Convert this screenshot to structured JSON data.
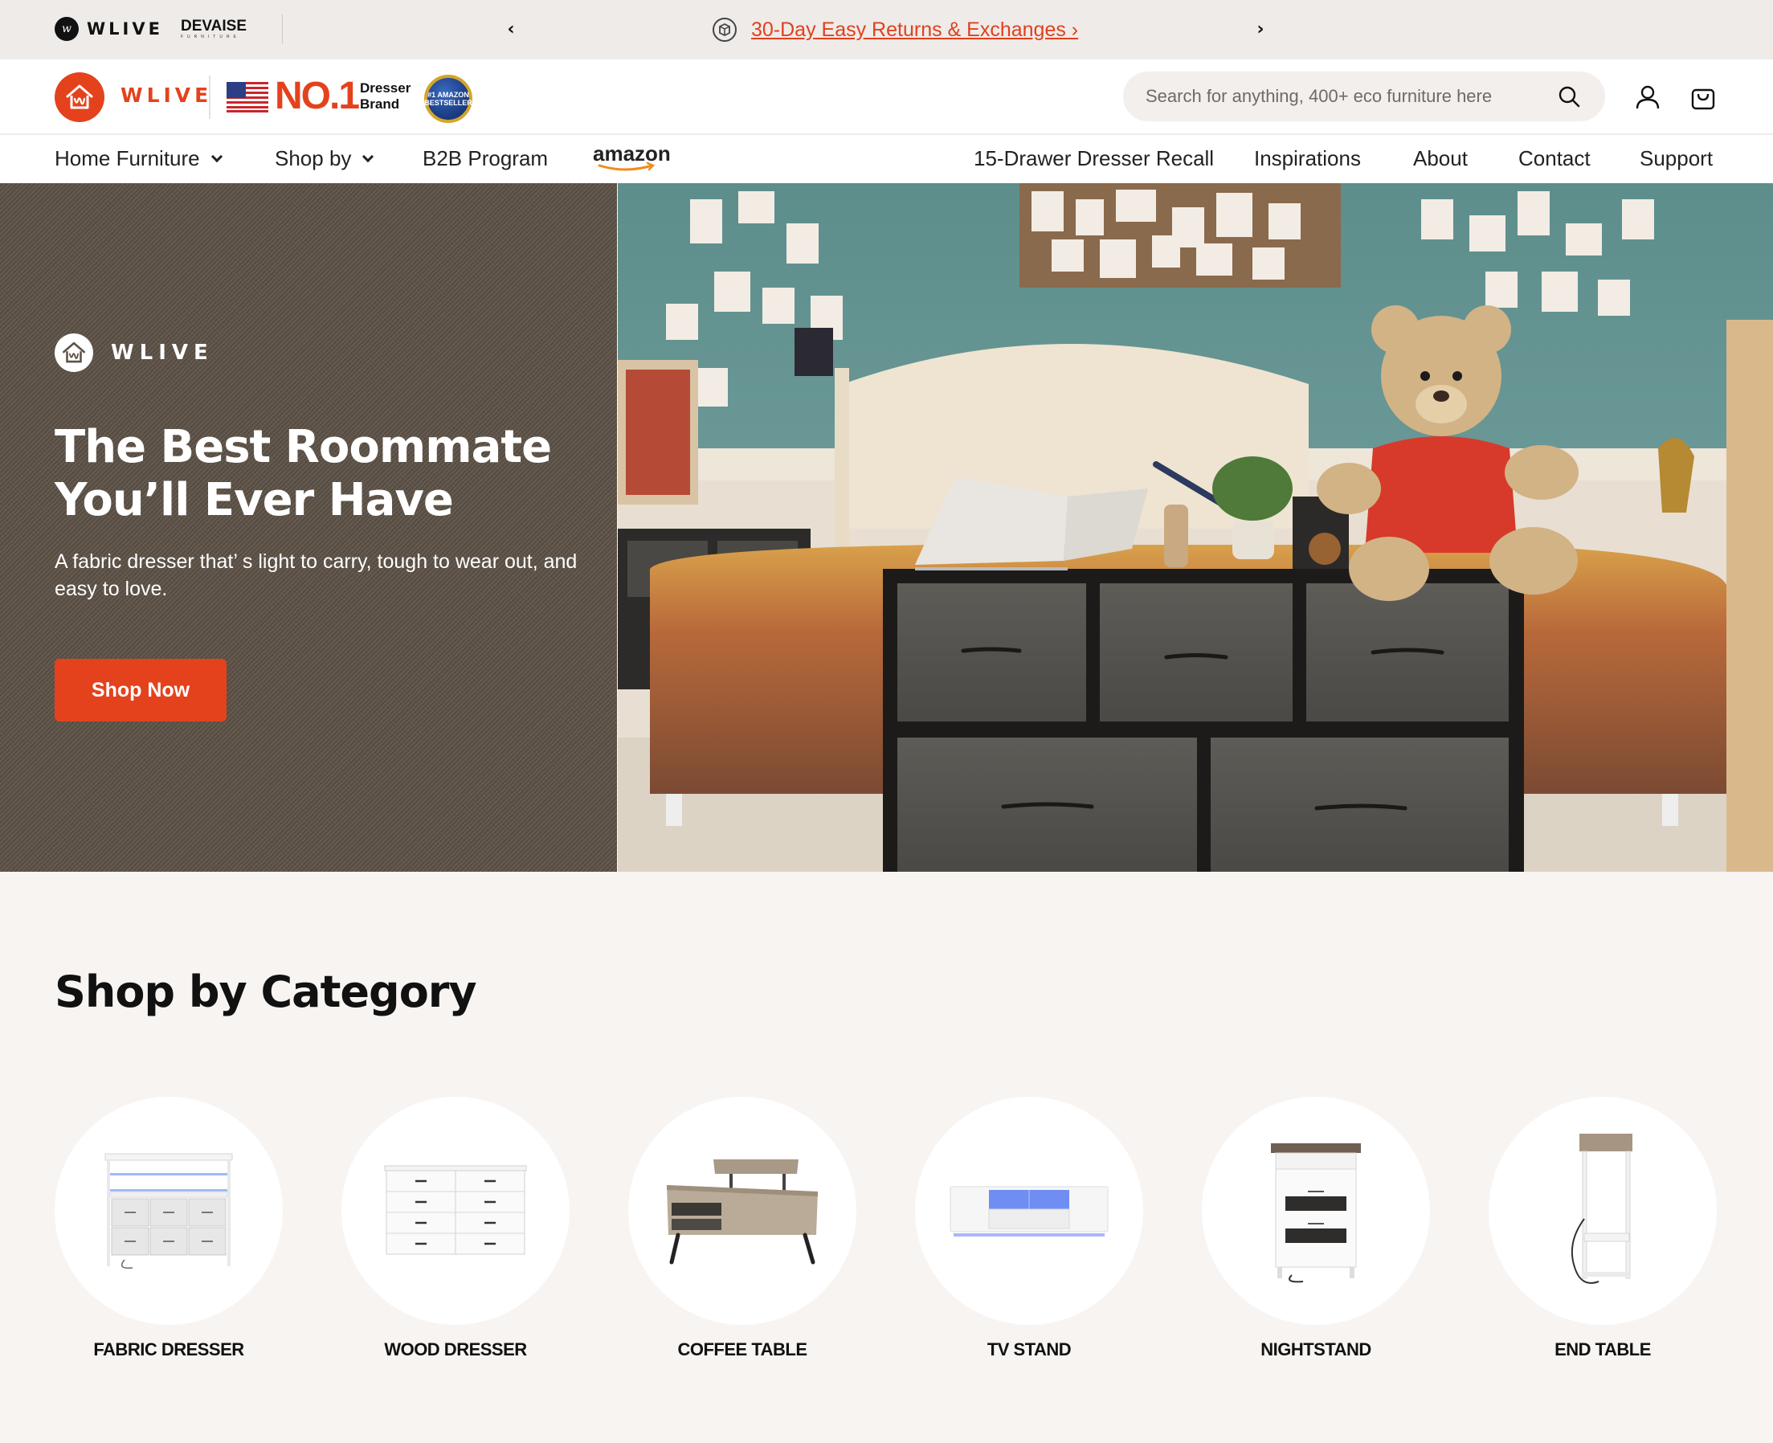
{
  "announcement": {
    "brand1": "WLIVE",
    "brand2_top": "DEVAISE",
    "brand2_bottom": "FURNITURE",
    "promo_text": "30-Day Easy Returns & Exchanges ›",
    "prev_icon": "chevron-left-icon",
    "next_icon": "chevron-right-icon"
  },
  "header": {
    "brand": "WLIVE",
    "no1": "NO.1",
    "no1_sub_line1": "Dresser",
    "no1_sub_line2": "Brand",
    "badge_text": "#1 AMAZON BESTSELLER",
    "search_placeholder": "Search for anything, 400+ eco furniture here",
    "icons": [
      "search-icon",
      "user-icon",
      "cart-icon"
    ]
  },
  "nav": {
    "left": [
      {
        "label": "Home Furniture",
        "dropdown": true
      },
      {
        "label": "Shop by",
        "dropdown": true
      },
      {
        "label": "B2B Program",
        "dropdown": false
      }
    ],
    "amazon": "amazon",
    "right": [
      {
        "label": "15-Drawer Dresser Recall"
      },
      {
        "label": "Inspirations"
      },
      {
        "label": "About"
      },
      {
        "label": "Contact"
      },
      {
        "label": "Support"
      }
    ]
  },
  "hero": {
    "logo_text": "WLIVE",
    "title_line1": "The Best Roommate",
    "title_line2": "You’ll Ever Have",
    "subtitle": "A fabric dresser that’ s light to carry, tough to wear out, and easy to love.",
    "cta": "Shop Now"
  },
  "categories": {
    "title": "Shop by Category",
    "items": [
      {
        "label": "FABRIC DRESSER"
      },
      {
        "label": "WOOD DRESSER"
      },
      {
        "label": "COFFEE TABLE"
      },
      {
        "label": "TV STAND"
      },
      {
        "label": "NIGHTSTAND"
      },
      {
        "label": "END TABLE"
      }
    ]
  },
  "colors": {
    "accent": "#e4421d",
    "page_bg": "#f7f4f2",
    "announcement_bg": "#efebe8",
    "hero_left_bg": "#5d5247"
  }
}
